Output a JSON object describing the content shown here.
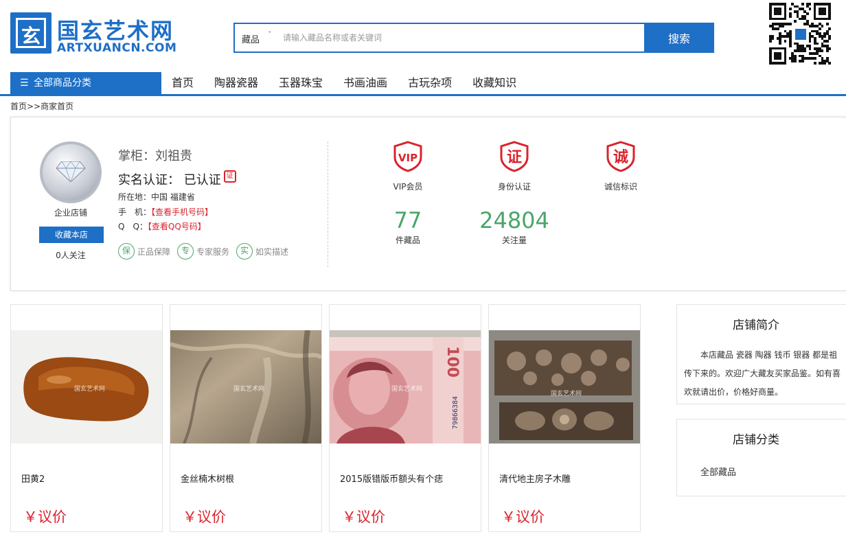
{
  "header": {
    "logo_cn": "国玄艺术网",
    "logo_en": "ARTXUANCN.COM",
    "logo_mark": "玄",
    "search": {
      "category": "藏品",
      "placeholder": "请输入藏品名称或者关键词",
      "button": "搜索"
    }
  },
  "nav": {
    "all_categories": "全部商品分类",
    "items": [
      "首页",
      "陶器瓷器",
      "玉器珠宝",
      "书画油画",
      "古玩杂项",
      "收藏知识"
    ]
  },
  "breadcrumb": "首页>>商家首页",
  "shop": {
    "type": "企业店铺",
    "favorite_button": "收藏本店",
    "followers": "0人关注",
    "owner": "掌柜：刘祖贵",
    "verify_label": "实名认证：",
    "verify_status": "已认证",
    "verify_badge": "证",
    "location_label": "所在地：",
    "location": "中国 福建省",
    "phone_label": "手　机：",
    "phone_link": "【查看手机号码】",
    "qq_label": "Q　Q：",
    "qq_link": "【查看QQ号码】",
    "guarantees": [
      {
        "icon": "保",
        "label": "正品保障"
      },
      {
        "icon": "专",
        "label": "专家服务"
      },
      {
        "icon": "实",
        "label": "如实描述"
      }
    ],
    "certs": [
      {
        "icon": "VIP",
        "label": "VIP会员"
      },
      {
        "icon": "证",
        "label": "身份认证"
      },
      {
        "icon": "诚",
        "label": "诚信标识"
      }
    ],
    "stats": [
      {
        "value": "77",
        "label": "件藏品"
      },
      {
        "value": "24804",
        "label": "关注量"
      }
    ]
  },
  "products": [
    {
      "title": "田黄2",
      "price": "￥议价",
      "watermark": "国玄艺术网"
    },
    {
      "title": "金丝楠木树根",
      "price": "￥议价",
      "watermark": "国玄艺术网"
    },
    {
      "title": "2015版错版币额头有个痣",
      "price": "￥议价",
      "watermark": "国玄艺术网"
    },
    {
      "title": "清代地主房子木雕",
      "price": "￥议价",
      "watermark": "国玄艺术网"
    }
  ],
  "banknote_text": "100",
  "banknote_serial": "79866384",
  "sidebar": {
    "intro_title": "店铺简介",
    "intro_text": "本店藏品 瓷器 陶器 钱币 银器 都是祖传下来的。欢迎广大藏友买家品鉴。如有喜欢就请出价，价格好商量。",
    "category_title": "店铺分类",
    "category_item": "全部藏品"
  },
  "colors": {
    "brand_blue": "#1e6fc6",
    "price_red": "#d9232d",
    "stat_green": "#4aa56a"
  }
}
